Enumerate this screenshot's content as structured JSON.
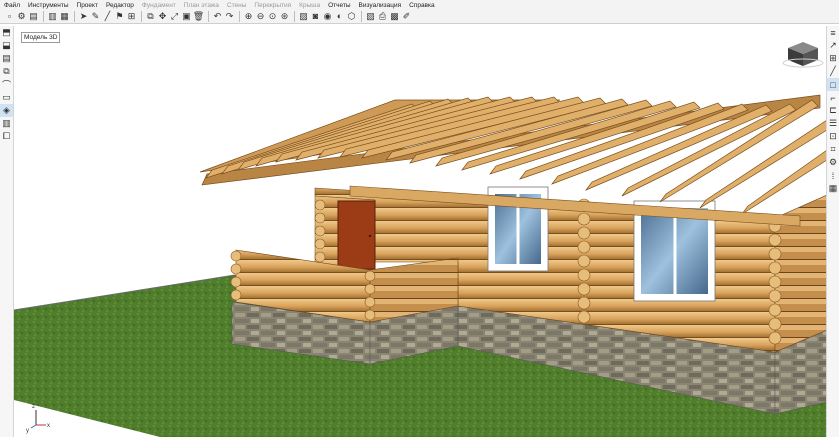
{
  "menu": [
    {
      "label": "Файл",
      "disabled": false
    },
    {
      "label": "Инструменты",
      "disabled": false
    },
    {
      "label": "Проект",
      "disabled": false
    },
    {
      "label": "Редактор",
      "disabled": false
    },
    {
      "label": "Фундамент",
      "disabled": true
    },
    {
      "label": "План этажа",
      "disabled": true
    },
    {
      "label": "Стены",
      "disabled": true
    },
    {
      "label": "Перекрытия",
      "disabled": true
    },
    {
      "label": "Крыша",
      "disabled": true
    },
    {
      "label": "Отчеты",
      "disabled": false
    },
    {
      "label": "Визуализация",
      "disabled": false
    },
    {
      "label": "Справка",
      "disabled": false
    }
  ],
  "viewport": {
    "label": "Модель 3D"
  },
  "axis": {
    "x": "x",
    "y": "y",
    "z": "z"
  },
  "colors": {
    "accent": "#cfe3f5",
    "grass": "#4f7d2c",
    "log": "#d4a05a",
    "door": "#9b3c17"
  }
}
